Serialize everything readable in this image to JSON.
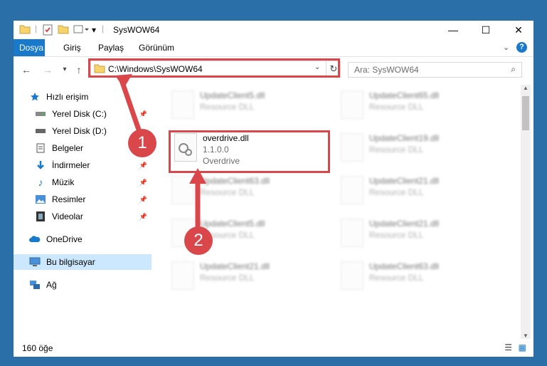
{
  "window": {
    "title": "SysWOW64"
  },
  "ribbon": {
    "tabs": [
      {
        "label": "Dosya",
        "active": true
      },
      {
        "label": "Giriş",
        "active": false
      },
      {
        "label": "Paylaş",
        "active": false
      },
      {
        "label": "Görünüm",
        "active": false
      }
    ]
  },
  "navigation": {
    "address": "C:\\Windows\\SysWOW64",
    "search_placeholder": "Ara: SysWOW64"
  },
  "sidebar": {
    "items": [
      {
        "label": "Hızlı erişim",
        "icon": "star-icon",
        "pinned": false
      },
      {
        "label": "Yerel Disk (C:)",
        "icon": "drive-icon",
        "pinned": true
      },
      {
        "label": "Yerel Disk (D:)",
        "icon": "drive-icon",
        "pinned": false
      },
      {
        "label": "Belgeler",
        "icon": "documents-icon",
        "pinned": true
      },
      {
        "label": "İndirmeler",
        "icon": "downloads-icon",
        "pinned": true
      },
      {
        "label": "Müzik",
        "icon": "music-icon",
        "pinned": true
      },
      {
        "label": "Resimler",
        "icon": "pictures-icon",
        "pinned": true
      },
      {
        "label": "Videolar",
        "icon": "videos-icon",
        "pinned": true
      },
      {
        "label": "OneDrive",
        "icon": "cloud-icon",
        "pinned": false
      },
      {
        "label": "Bu bilgisayar",
        "icon": "computer-icon",
        "pinned": false,
        "selected": true
      },
      {
        "label": "Ağ",
        "icon": "network-icon",
        "pinned": false
      }
    ]
  },
  "files": {
    "highlighted": {
      "name": "overdrive.dll",
      "version": "1.1.0.0",
      "description": "Overdrive"
    },
    "left_column": [
      {
        "name": "UpdateClient5.dll",
        "type": "Resource DLL"
      },
      {
        "name": "UpdateClient63.dll",
        "type": "Resource DLL"
      },
      {
        "name": "UpdateClient5.dll",
        "type": "Resource DLL"
      },
      {
        "name": "UpdateClient21.dll",
        "type": "Resource DLL"
      }
    ],
    "right_column": [
      {
        "name": "UpdateClient65.dll",
        "type": "Resource DLL"
      },
      {
        "name": "UpdateClient19.dll",
        "type": "Resource DLL"
      },
      {
        "name": "UpdateClient21.dll",
        "type": "Resource DLL"
      },
      {
        "name": "UpdateClient21.dll",
        "type": "Resource DLL"
      },
      {
        "name": "UpdateClient63.dll",
        "type": "Resource DLL"
      }
    ]
  },
  "status": {
    "count": "160 öğe"
  },
  "annotations": {
    "step1": "1",
    "step2": "2"
  },
  "colors": {
    "accent": "#1979ca",
    "highlight": "#d9474b",
    "selection": "#cce8ff"
  }
}
